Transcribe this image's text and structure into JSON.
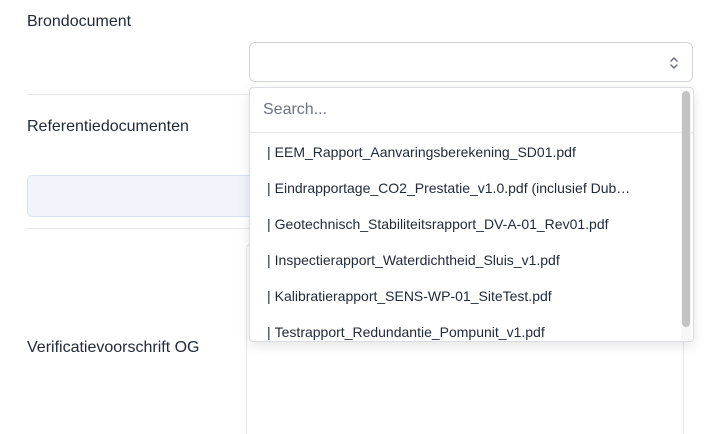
{
  "form": {
    "brondocument_label": "Brondocument",
    "referentiedocumenten_label": "Referentiedocumenten",
    "verificatievoorschrift_label": "Verificatievoorschrift OG"
  },
  "dropdown": {
    "search_placeholder": "Search...",
    "options": [
      "EEM_Rapport_Aanvaringsberekening_SD01.pdf",
      "Eindrapportage_CO2_Prestatie_v1.0.pdf (inclusief Dub…",
      "Geotechnisch_Stabiliteitsrapport_DV-A-01_Rev01.pdf",
      "Inspectierapport_Waterdichtheid_Sluis_v1.pdf",
      "Kalibratierapport_SENS-WP-01_SiteTest.pdf",
      "Testrapport_Redundantie_Pompunit_v1.pdf"
    ],
    "option_prefix": "|"
  }
}
